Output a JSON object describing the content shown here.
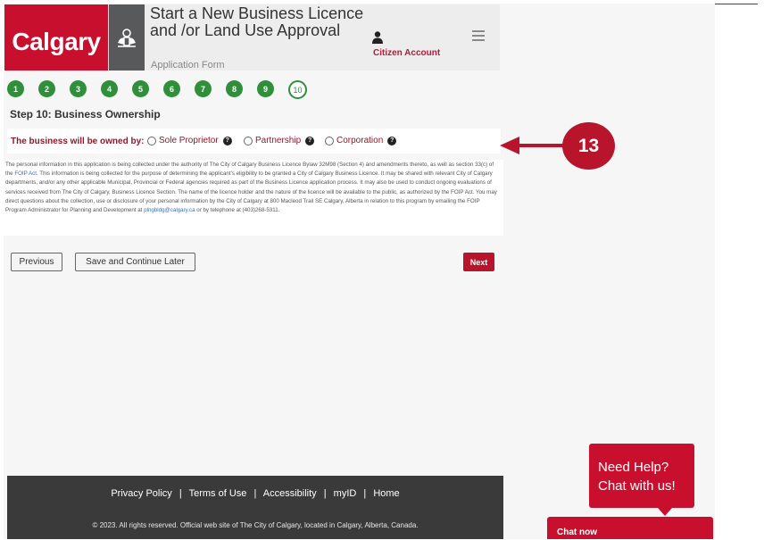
{
  "header": {
    "logo_text": "Calgary",
    "title": "Start a New Business Licence and /or Land Use Approval",
    "subtitle": "Application Form",
    "account_label": "Citizen Account"
  },
  "steps": [
    "1",
    "2",
    "3",
    "4",
    "5",
    "6",
    "7",
    "8",
    "9",
    "10"
  ],
  "current_step": 10,
  "step_heading": "Step 10: Business Ownership",
  "ownership": {
    "label": "The business will be owned by:",
    "options": [
      "Sole Proprietor",
      "Partnership",
      "Corporation"
    ]
  },
  "legal": {
    "part1": "The personal information in this application is being collected under the authority of The City of Calgary Business Licence Bylaw 32M98 (Section 4) and amendments thereto, as well as section 33(c) of the ",
    "foip_link": "FOIP Act",
    "part2": ". This information is being collected for the purpose of determining the applicant's eligibility to be granted a City of Calgary Business Licence. It may be shared with relevant City of Calgary departments, and/or any other applicable Municipal, Provincial or Federal agencies required as part of the Business Licence application process. It may also be used to conduct ongoing evaluations of services received from The City of Calgary, Business Licence Section. The name of the licence holder and the nature of the licence will be available to the public, as authorized by the FOIP Act. You may direct questions about the collection, use or disclosure of your personal information by the City of Calgary at 800 Macleod Trail SE Calgary, Alberta in relation to this program by emailing the FOIP Program Administrator for Planning and Development at ",
    "email_link": "plngbldg@calgary.ca",
    "part3": " or by telephone at (403)268-5311."
  },
  "buttons": {
    "previous": "Previous",
    "save_later": "Save and Continue Later",
    "next": "Next"
  },
  "annotation": "13",
  "footer": {
    "links": [
      "Privacy Policy",
      "Terms of Use",
      "Accessibility",
      "myID",
      "Home"
    ],
    "separator": "|",
    "copyright": "© 2023. All rights reserved. Official web site of The City of Calgary, located in Calgary, Alberta, Canada."
  },
  "chat": {
    "bubble_line1": "Need Help?",
    "bubble_line2": "Chat with us!",
    "chat_now": "Chat now"
  },
  "colors": {
    "brand_red": "#c8102e",
    "step_green": "#2f8f3a",
    "footer_dark": "#3a3a3a"
  }
}
